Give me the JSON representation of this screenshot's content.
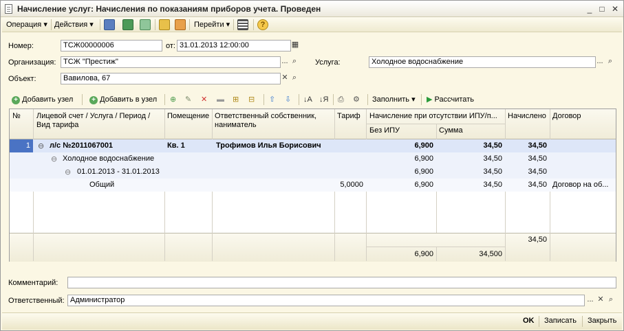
{
  "window": {
    "title": "Начисление услуг: Начисления по показаниям приборов учета. Проведен",
    "minimize": "_",
    "maximize": "□",
    "close": "✕"
  },
  "cmdbar": {
    "operation": "Операция",
    "actions": "Действия",
    "goto": "Перейти",
    "help": "?"
  },
  "form": {
    "number_label": "Номер:",
    "number_value": "ТСЖ00000006",
    "from_label": "от:",
    "date_value": "31.01.2013 12:00:00",
    "org_label": "Организация:",
    "org_value": "ТСЖ \"Престиж\"",
    "service_label": "Услуга:",
    "service_value": "Холодное водоснабжение",
    "object_label": "Объект:",
    "object_value": "Вавилова, 67",
    "comment_label": "Комментарий:",
    "comment_value": "",
    "responsible_label": "Ответственный:",
    "responsible_value": "Администратор"
  },
  "table_toolbar": {
    "add_node": "Добавить узел",
    "add_into_node": "Добавить в узел",
    "fill": "Заполнить",
    "calculate": "Рассчитать"
  },
  "table": {
    "headers": {
      "num": "№",
      "account": "Лицевой счет / Услуга / Период / Вид тарифа",
      "premises": "Помещение",
      "owner": "Ответственный собственник, наниматель",
      "tariff": "Тариф",
      "accrual_group": "Начисление при отсутствии ИПУ/п...",
      "without_ipu": "Без ИПУ",
      "sum": "Сумма",
      "accrued": "Начислено",
      "contract": "Договор"
    },
    "rows": [
      {
        "num": "1",
        "toggle": "⊖",
        "account": "л/с №2011067001",
        "premises": "Кв. 1",
        "owner": "Трофимов Илья Борисович",
        "tariff": "",
        "without_ipu": "6,900",
        "sum": "34,50",
        "accrued": "34,50",
        "contract": ""
      },
      {
        "num": "",
        "toggle": "⊖",
        "account": "Холодное водоснабжение",
        "premises": "",
        "owner": "",
        "tariff": "",
        "without_ipu": "6,900",
        "sum": "34,50",
        "accrued": "34,50",
        "contract": ""
      },
      {
        "num": "",
        "toggle": "⊖",
        "account": "01.01.2013 - 31.01.2013",
        "premises": "",
        "owner": "",
        "tariff": "",
        "without_ipu": "6,900",
        "sum": "34,50",
        "accrued": "34,50",
        "contract": ""
      },
      {
        "num": "",
        "toggle": "",
        "account": "Общий",
        "premises": "",
        "owner": "",
        "tariff": "5,0000",
        "without_ipu": "6,900",
        "sum": "34,50",
        "accrued": "34,50",
        "contract": "Договор на об..."
      }
    ],
    "footer": {
      "accrued_total": "34,50",
      "without_ipu_total": "6,900",
      "sum_total": "34,500"
    }
  },
  "bottom": {
    "ok": "OK",
    "save": "Записать",
    "close": "Закрыть"
  },
  "colors": {
    "form_bg": "#fbf7e4",
    "selected_row": "#dde6f8",
    "number_cell": "#4a73c4"
  }
}
